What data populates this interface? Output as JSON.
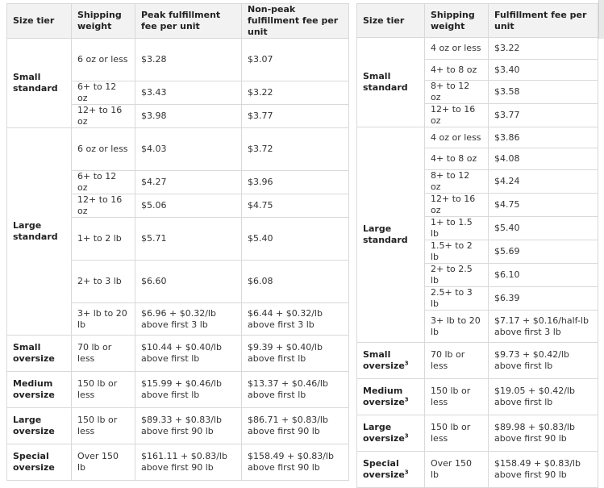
{
  "left_table": {
    "headers": {
      "size_tier": "Size tier",
      "shipping_weight": "Shipping weight",
      "peak": "Peak fulfillment fee per unit",
      "nonpeak": "Non-peak fulfillment fee per unit"
    },
    "tiers": {
      "small_standard": "Small standard",
      "large_standard": "Large standard",
      "small_oversize": "Small oversize",
      "medium_oversize": "Medium oversize",
      "large_oversize": "Large oversize",
      "special_oversize": "Special oversize"
    },
    "rows": [
      {
        "weight": "6 oz or less",
        "peak": "$3.28",
        "nonpeak": "$3.07"
      },
      {
        "weight": "6+ to 12 oz",
        "peak": "$3.43",
        "nonpeak": "$3.22"
      },
      {
        "weight": "12+ to 16 oz",
        "peak": "$3.98",
        "nonpeak": "$3.77"
      },
      {
        "weight": "6 oz or less",
        "peak": "$4.03",
        "nonpeak": "$3.72"
      },
      {
        "weight": "6+ to 12 oz",
        "peak": "$4.27",
        "nonpeak": "$3.96"
      },
      {
        "weight": "12+ to 16 oz",
        "peak": "$5.06",
        "nonpeak": "$4.75"
      },
      {
        "weight": "1+ to 2 lb",
        "peak": "$5.71",
        "nonpeak": "$5.40"
      },
      {
        "weight": "2+ to 3 lb",
        "peak": "$6.60",
        "nonpeak": "$6.08"
      },
      {
        "weight": "3+ lb to 20 lb",
        "peak": "$6.96 + $0.32/lb above first 3 lb",
        "nonpeak": "$6.44 + $0.32/lb above first 3 lb"
      },
      {
        "weight": "70 lb or less",
        "peak": "$10.44 + $0.40/lb above first lb",
        "nonpeak": "$9.39 + $0.40/lb above first lb"
      },
      {
        "weight": "150 lb or less",
        "peak": "$15.99 + $0.46/lb above first lb",
        "nonpeak": "$13.37 + $0.46/lb above first lb"
      },
      {
        "weight": "150 lb or less",
        "peak": "$89.33 + $0.83/lb above first 90 lb",
        "nonpeak": "$86.71 + $0.83/lb above first 90 lb"
      },
      {
        "weight": "Over 150 lb",
        "peak": "$161.11 + $0.83/lb above first 90 lb",
        "nonpeak": "$158.49 + $0.83/lb above first 90 lb"
      }
    ]
  },
  "right_table": {
    "headers": {
      "size_tier": "Size tier",
      "shipping_weight": "Shipping weight",
      "fee": "Fulfillment fee per unit"
    },
    "tiers": {
      "small_standard": "Small standard",
      "large_standard": "Large standard",
      "small_oversize": "Small oversize",
      "medium_oversize": "Medium oversize",
      "large_oversize": "Large oversize",
      "special_oversize": "Special oversize",
      "footnote": "3"
    },
    "rows": [
      {
        "weight": "4 oz or less",
        "fee": "$3.22"
      },
      {
        "weight": "4+ to 8 oz",
        "fee": "$3.40"
      },
      {
        "weight": "8+ to 12 oz",
        "fee": "$3.58"
      },
      {
        "weight": "12+ to 16 oz",
        "fee": "$3.77"
      },
      {
        "weight": "4 oz or less",
        "fee": "$3.86"
      },
      {
        "weight": "4+ to 8 oz",
        "fee": "$4.08"
      },
      {
        "weight": "8+ to 12 oz",
        "fee": "$4.24"
      },
      {
        "weight": "12+ to 16 oz",
        "fee": "$4.75"
      },
      {
        "weight": "1+ to 1.5 lb",
        "fee": "$5.40"
      },
      {
        "weight": "1.5+ to 2 lb",
        "fee": "$5.69"
      },
      {
        "weight": "2+ to 2.5 lb",
        "fee": "$6.10"
      },
      {
        "weight": "2.5+ to 3 lb",
        "fee": "$6.39"
      },
      {
        "weight": "3+ lb to 20 lb",
        "fee": "$7.17 + $0.16/half-lb above first 3 lb"
      },
      {
        "weight": "70 lb or less",
        "fee": "$9.73 + $0.42/lb above first lb"
      },
      {
        "weight": "150 lb or less",
        "fee": "$19.05 + $0.42/lb above first lb"
      },
      {
        "weight": "150 lb or less",
        "fee": "$89.98 + $0.83/lb above first 90 lb"
      },
      {
        "weight": "Over 150 lb",
        "fee": "$158.49 + $0.83/lb above first 90 lb"
      }
    ]
  }
}
